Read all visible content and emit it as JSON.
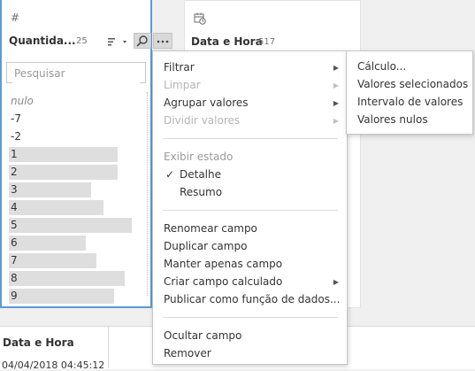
{
  "qty_card": {
    "type_icon": "#",
    "title": "Quantida...",
    "count": "25",
    "search_placeholder": "Pesquisar",
    "values": [
      {
        "label": "nulo",
        "null": true,
        "bar": 0
      },
      {
        "label": "-7",
        "bar": 0
      },
      {
        "label": "-2",
        "bar": 0
      },
      {
        "label": "1",
        "bar": 0.85
      },
      {
        "label": "2",
        "bar": 0.85
      },
      {
        "label": "3",
        "bar": 0.64
      },
      {
        "label": "4",
        "bar": 0.74
      },
      {
        "label": "5",
        "bar": 0.96
      },
      {
        "label": "6",
        "bar": 0.6
      },
      {
        "label": "7",
        "bar": 0.68
      },
      {
        "label": "8",
        "bar": 0.9
      },
      {
        "label": "9",
        "bar": 0.82
      }
    ]
  },
  "date_card": {
    "type_icon": "calendar-clock-icon",
    "title": "Data e Hora",
    "count": "517"
  },
  "grid": {
    "header": "Data e Hora",
    "first_cell": "04/04/2018 04:45:12"
  },
  "menu": {
    "filtrar": "Filtrar",
    "limpar": "Limpar",
    "agrupar": "Agrupar valores",
    "dividir": "Dividir valores",
    "exibir_estado": "Exibir estado",
    "detalhe": "Detalhe",
    "resumo": "Resumo",
    "renomear": "Renomear campo",
    "duplicar": "Duplicar campo",
    "manter": "Manter apenas campo",
    "criar": "Criar campo calculado",
    "publicar": "Publicar como função de dados...",
    "ocultar": "Ocultar campo",
    "remover": "Remover",
    "check_glyph": "✓"
  },
  "submenu": {
    "calculo": "Cálculo...",
    "valores_selecionados": "Valores selecionados",
    "intervalo": "Intervalo de valores",
    "valores_nulos": "Valores nulos"
  },
  "colors": {
    "accent_border": "#5b9bd5",
    "bar": "#dedede"
  }
}
